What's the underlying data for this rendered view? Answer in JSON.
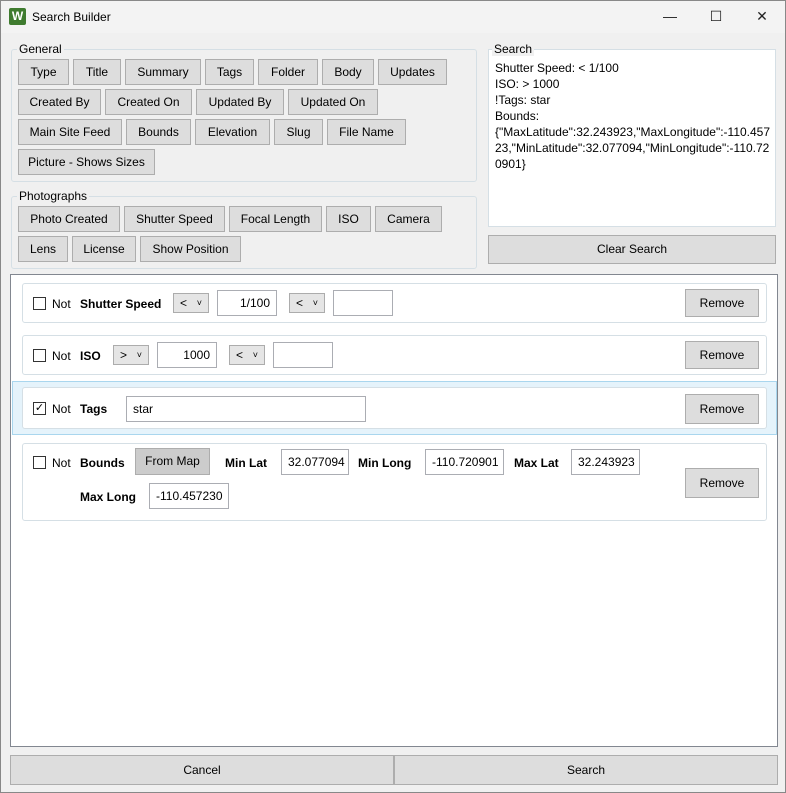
{
  "window": {
    "title": "Search Builder",
    "icon_letter": "W",
    "minimize": "—",
    "maximize": "☐",
    "close": "✕"
  },
  "general": {
    "label": "General",
    "buttons": [
      "Type",
      "Title",
      "Summary",
      "Tags",
      "Folder",
      "Body",
      "Updates",
      "Created By",
      "Created On",
      "Updated By",
      "Updated On",
      "Main Site Feed",
      "Bounds",
      "Elevation",
      "Slug",
      "File Name",
      "Picture - Shows Sizes"
    ]
  },
  "photographs": {
    "label": "Photographs",
    "buttons": [
      "Photo Created",
      "Shutter Speed",
      "Focal Length",
      "ISO",
      "Camera",
      "Lens",
      "License",
      "Show Position"
    ]
  },
  "search": {
    "label": "Search",
    "lines": [
      "Shutter Speed: < 1/100",
      "ISO: > 1000",
      "!Tags: star",
      "Bounds:",
      "{\"MaxLatitude\":32.243923,\"MaxLongitude\":-110.45723,\"MinLatitude\":32.077094,\"MinLongitude\":-110.720901}"
    ],
    "clear_label": "Clear Search"
  },
  "filters": {
    "not_label": "Not",
    "remove_label": "Remove",
    "shutter": {
      "name": "Shutter Speed",
      "op1": "<",
      "value1": "1/100",
      "op2": "<",
      "value2": "",
      "not_checked": false
    },
    "iso": {
      "name": "ISO",
      "op1": ">",
      "value1": "1000",
      "op2": "<",
      "value2": "",
      "not_checked": false
    },
    "tags": {
      "name": "Tags",
      "value": "star",
      "not_checked": true,
      "check_mark": "✓"
    },
    "bounds": {
      "name": "Bounds",
      "from_map": "From Map",
      "min_lat_label": "Min Lat",
      "min_lat": "32.077094",
      "min_long_label": "Min Long",
      "min_long": "-110.720901",
      "max_lat_label": "Max Lat",
      "max_lat": "32.243923",
      "max_long_label": "Max Long",
      "max_long": "-110.457230",
      "not_checked": false
    }
  },
  "footer": {
    "cancel": "Cancel",
    "search": "Search"
  }
}
